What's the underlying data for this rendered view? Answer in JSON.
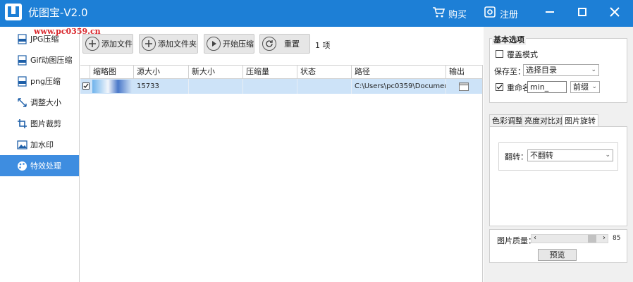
{
  "titlebar": {
    "title": "优图宝-V2.0",
    "watermark": "www.pc0359.cn",
    "buy_label": "购买",
    "register_label": "注册"
  },
  "sidebar": {
    "items": [
      {
        "label": "JPG压缩",
        "icon": "jpg-file-icon"
      },
      {
        "label": "Gif动图压缩",
        "icon": "gif-file-icon"
      },
      {
        "label": "png压缩",
        "icon": "png-file-icon"
      },
      {
        "label": "调整大小",
        "icon": "resize-icon"
      },
      {
        "label": "图片裁剪",
        "icon": "crop-icon"
      },
      {
        "label": "加水印",
        "icon": "watermark-icon"
      },
      {
        "label": "特效处理",
        "icon": "palette-icon"
      }
    ],
    "active_index": 6
  },
  "toolbar": {
    "add_file": "添加文件",
    "add_folder": "添加文件夹",
    "start": "开始压缩",
    "reset": "重置",
    "count": "1 项"
  },
  "table": {
    "columns": [
      "缩略图",
      "源大小",
      "新大小",
      "压缩量",
      "状态",
      "路径",
      "输出"
    ],
    "rows": [
      {
        "checked": true,
        "source_size": "15733",
        "new_size": "",
        "ratio": "",
        "status": "",
        "path": "C:\\Users\\pc0359\\Documents..."
      }
    ]
  },
  "options": {
    "group_title": "基本选项",
    "overwrite_label": "覆盖模式",
    "overwrite_checked": false,
    "save_to_label": "保存至：",
    "save_to_value": "选择目录",
    "rename_label": "重命名",
    "rename_checked": true,
    "rename_value": "min_",
    "rename_pos_value": "前缀"
  },
  "tabs": {
    "items": [
      "色彩调整",
      "亮度对比对",
      "图片旋转"
    ],
    "active_index": 2
  },
  "rotate": {
    "flip_label": "翻转：",
    "flip_value": "不翻转"
  },
  "quality": {
    "label": "图片质量：",
    "value_text": "85",
    "value": 85,
    "preview_label": "预览"
  },
  "colors": {
    "titlebar": "#1d7fd6",
    "active_item": "#3e8de0",
    "selected_row": "#cde3f8"
  }
}
